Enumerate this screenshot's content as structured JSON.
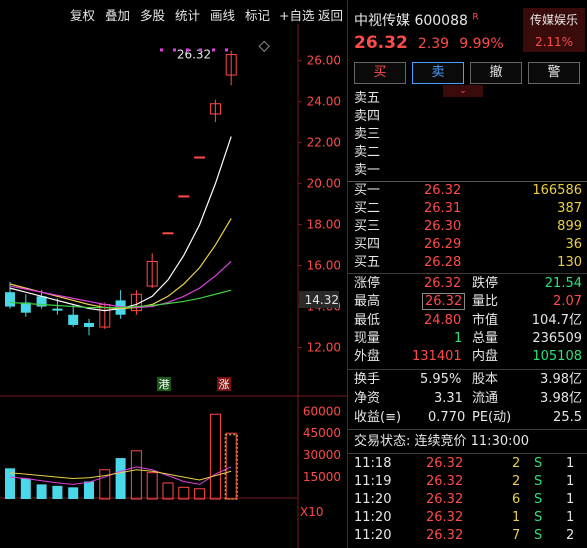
{
  "toolbar": {
    "buttons": [
      "复权",
      "叠加",
      "多股",
      "统计",
      "画线",
      "标记",
      "+自选",
      "返回"
    ]
  },
  "chart": {
    "price_axis": [
      "26.00",
      "24.00",
      "22.00",
      "20.00",
      "18.00",
      "16.00",
      "14.00",
      "12.00"
    ],
    "current_price_tag": "14.32",
    "last_price_label": "26.32",
    "badge_gang": "港",
    "badge_zhang": "涨",
    "volume_axis": [
      "60000",
      "45000",
      "30000",
      "15000"
    ],
    "volume_unit": "X10"
  },
  "chart_data": {
    "type": "candlestick",
    "price_range": [
      11,
      27.5
    ],
    "candles": [
      {
        "o": 14.7,
        "h": 15.2,
        "l": 13.9,
        "c": 14.0,
        "up": false
      },
      {
        "o": 14.2,
        "h": 14.6,
        "l": 13.5,
        "c": 13.7,
        "up": false
      },
      {
        "o": 14.5,
        "h": 14.8,
        "l": 13.9,
        "c": 14.0,
        "up": false
      },
      {
        "o": 13.9,
        "h": 14.4,
        "l": 13.6,
        "c": 13.8,
        "up": false
      },
      {
        "o": 13.6,
        "h": 14.1,
        "l": 13.0,
        "c": 13.1,
        "up": false
      },
      {
        "o": 13.0,
        "h": 13.4,
        "l": 12.6,
        "c": 13.2,
        "up": false
      },
      {
        "o": 13.0,
        "h": 14.2,
        "l": 12.9,
        "c": 14.1,
        "up": true
      },
      {
        "o": 14.3,
        "h": 14.8,
        "l": 13.4,
        "c": 13.6,
        "up": false
      },
      {
        "o": 13.8,
        "h": 14.8,
        "l": 13.6,
        "c": 14.6,
        "up": true
      },
      {
        "o": 15.0,
        "h": 16.6,
        "l": 14.9,
        "c": 16.2,
        "up": true
      },
      {
        "o": 17.6,
        "h": 17.6,
        "l": 17.6,
        "c": 17.6,
        "up": true
      },
      {
        "o": 19.4,
        "h": 19.4,
        "l": 19.4,
        "c": 19.4,
        "up": true
      },
      {
        "o": 21.3,
        "h": 21.3,
        "l": 21.3,
        "c": 21.3,
        "up": true
      },
      {
        "o": 23.4,
        "h": 24.1,
        "l": 23.0,
        "c": 23.9,
        "up": true
      },
      {
        "o": 25.3,
        "h": 26.5,
        "l": 24.8,
        "c": 26.3,
        "up": true
      }
    ],
    "ma_series": [
      {
        "color": "#ffffff",
        "values": [
          14.9,
          14.7,
          14.5,
          14.3,
          14.1,
          13.9,
          13.8,
          13.9,
          14.1,
          14.5,
          15.3,
          16.5,
          18.0,
          20.0,
          22.3
        ]
      },
      {
        "color": "#e8d048",
        "values": [
          15.1,
          14.9,
          14.7,
          14.5,
          14.3,
          14.1,
          13.95,
          13.9,
          13.95,
          14.1,
          14.5,
          15.1,
          15.9,
          17.0,
          18.3
        ]
      },
      {
        "color": "#e040e0",
        "values": [
          15.0,
          14.85,
          14.7,
          14.55,
          14.4,
          14.25,
          14.1,
          14.0,
          13.95,
          14.0,
          14.2,
          14.5,
          14.9,
          15.5,
          16.2
        ]
      },
      {
        "color": "#40d040",
        "values": [
          14.2,
          14.15,
          14.1,
          14.05,
          14.0,
          13.95,
          13.95,
          13.95,
          14.0,
          14.05,
          14.15,
          14.25,
          14.4,
          14.6,
          14.8
        ]
      }
    ],
    "volumes": [
      21000,
      14000,
      10000,
      9000,
      8000,
      12000,
      20000,
      28000,
      33000,
      18000,
      11000,
      8000,
      7000,
      58000,
      45000
    ],
    "vol_range": [
      0,
      65000
    ]
  },
  "quote": {
    "name": "中视传媒",
    "code": "600088",
    "flag": "R",
    "price": "26.32",
    "change": "2.39",
    "change_pct": "9.99%",
    "sector_name": "传媒娱乐",
    "sector_pct": "2.11%"
  },
  "trade_buttons": [
    "买",
    "卖",
    "撤",
    "警"
  ],
  "asks": [
    {
      "label": "卖五"
    },
    {
      "label": "卖四"
    },
    {
      "label": "卖三"
    },
    {
      "label": "卖二"
    },
    {
      "label": "卖一"
    }
  ],
  "bids": [
    {
      "label": "买一",
      "price": "26.32",
      "vol": "166586"
    },
    {
      "label": "买二",
      "price": "26.31",
      "vol": "387"
    },
    {
      "label": "买三",
      "price": "26.30",
      "vol": "899"
    },
    {
      "label": "买四",
      "price": "26.29",
      "vol": "36"
    },
    {
      "label": "买五",
      "price": "26.28",
      "vol": "130"
    }
  ],
  "stats": {
    "limit_up_label": "涨停",
    "limit_up": "26.32",
    "limit_down_label": "跌停",
    "limit_down": "21.54",
    "high_label": "最高",
    "high": "26.32",
    "vol_ratio_label": "量比",
    "vol_ratio": "2.07",
    "low_label": "最低",
    "low": "24.80",
    "mkt_cap_label": "市值",
    "mkt_cap": "104.7亿",
    "last_vol_label": "现量",
    "last_vol": "1",
    "total_vol_label": "总量",
    "total_vol": "236509",
    "outer_label": "外盘",
    "outer": "131401",
    "inner_label": "内盘",
    "inner": "105108",
    "turnover_label": "换手",
    "turnover": "5.95%",
    "equity_label": "股本",
    "equity": "3.98亿",
    "nav_label": "净资",
    "nav": "3.31",
    "float_label": "流通",
    "float": "3.98亿",
    "eps_label": "收益(≡)",
    "eps": "0.770",
    "pe_label": "PE(动)",
    "pe": "25.5"
  },
  "trade_status": "交易状态: 连续竞价 11:30:00",
  "ticks": [
    {
      "time": "11:18",
      "price": "26.32",
      "vol": "2",
      "side": "S",
      "n": "1"
    },
    {
      "time": "11:19",
      "price": "26.32",
      "vol": "2",
      "side": "S",
      "n": "1"
    },
    {
      "time": "11:20",
      "price": "26.32",
      "vol": "6",
      "side": "S",
      "n": "1"
    },
    {
      "time": "11:20",
      "price": "26.32",
      "vol": "1",
      "side": "S",
      "n": "1"
    },
    {
      "time": "11:20",
      "price": "26.32",
      "vol": "7",
      "side": "S",
      "n": "2"
    }
  ]
}
